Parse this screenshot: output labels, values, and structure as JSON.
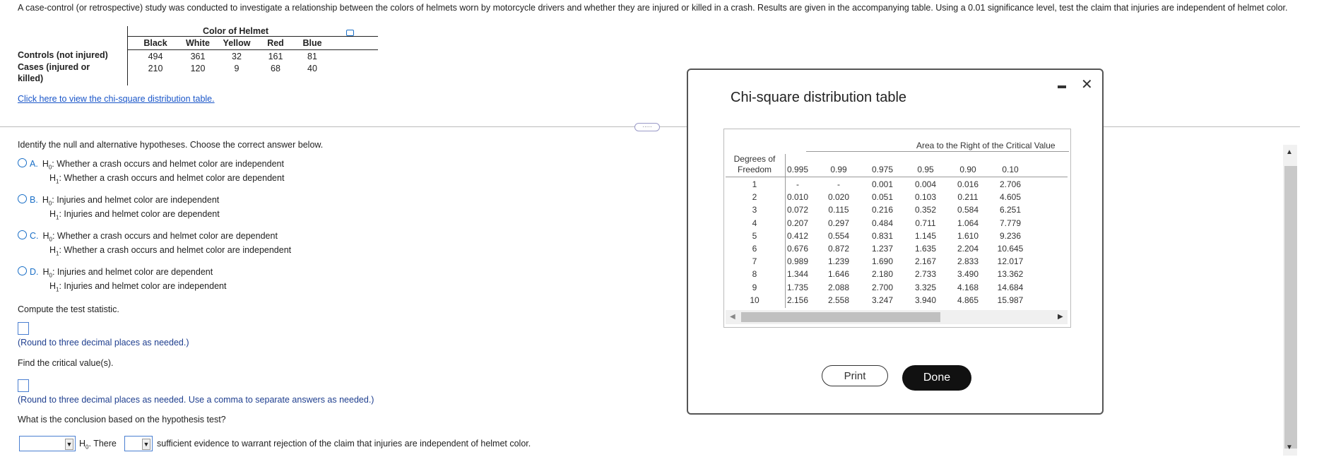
{
  "problem_text": "A case-control (or retrospective) study was conducted to investigate a relationship between the colors of helmets worn by motorcycle drivers and whether they are injured or killed in a crash. Results are given in the accompanying table. Using a 0.01 significance level, test the claim that injuries are independent of helmet color.",
  "data_table": {
    "group_header": "Color of Helmet",
    "columns": [
      "Black",
      "White",
      "Yellow",
      "Red",
      "Blue"
    ],
    "rows": [
      {
        "label": "Controls (not injured)",
        "values": [
          "494",
          "361",
          "32",
          "161",
          "81"
        ]
      },
      {
        "label": "Cases (injured or killed)",
        "values": [
          "210",
          "120",
          "9",
          "68",
          "40"
        ]
      }
    ]
  },
  "chi_link": "Click here to view the chi-square distribution table.",
  "question1": "Identify the null and alternative hypotheses. Choose the correct answer below.",
  "options": [
    {
      "letter": "A.",
      "h0": ": Whether a crash occurs and helmet color are independent",
      "h1": ": Whether a crash occurs and helmet color are dependent"
    },
    {
      "letter": "B.",
      "h0": ": Injuries and helmet color are independent",
      "h1": ": Injuries and helmet color are dependent"
    },
    {
      "letter": "C.",
      "h0": ": Whether a crash occurs and helmet color are dependent",
      "h1": ": Whether a crash occurs and helmet color are independent"
    },
    {
      "letter": "D.",
      "h0": ": Injuries and helmet color are dependent",
      "h1": ": Injuries and helmet color are independent"
    }
  ],
  "question2": "Compute the test statistic.",
  "note2": "(Round to three decimal places as needed.)",
  "question3": "Find the critical value(s).",
  "note3": "(Round to three decimal places as needed. Use a comma to separate answers as needed.)",
  "question4": "What is the conclusion based on the hypothesis test?",
  "conclusion": {
    "h0_prefix": "H",
    "there": ". There",
    "tail": "sufficient evidence to warrant rejection of the claim that injuries are independent of helmet color."
  },
  "modal": {
    "title": "Chi-square distribution table",
    "area_header": "Area to the Right of the Critical Value",
    "df_header": "Degrees of Freedom",
    "columns": [
      "0.995",
      "0.99",
      "0.975",
      "0.95",
      "0.90",
      "0.10"
    ],
    "rows": [
      {
        "df": "1",
        "vals": [
          "-",
          "-",
          "0.001",
          "0.004",
          "0.016",
          "2.706"
        ]
      },
      {
        "df": "2",
        "vals": [
          "0.010",
          "0.020",
          "0.051",
          "0.103",
          "0.211",
          "4.605"
        ]
      },
      {
        "df": "3",
        "vals": [
          "0.072",
          "0.115",
          "0.216",
          "0.352",
          "0.584",
          "6.251"
        ]
      },
      {
        "df": "4",
        "vals": [
          "0.207",
          "0.297",
          "0.484",
          "0.711",
          "1.064",
          "7.779"
        ]
      },
      {
        "df": "5",
        "vals": [
          "0.412",
          "0.554",
          "0.831",
          "1.145",
          "1.610",
          "9.236"
        ]
      },
      {
        "df": "6",
        "vals": [
          "0.676",
          "0.872",
          "1.237",
          "1.635",
          "2.204",
          "10.645"
        ]
      },
      {
        "df": "7",
        "vals": [
          "0.989",
          "1.239",
          "1.690",
          "2.167",
          "2.833",
          "12.017"
        ]
      },
      {
        "df": "8",
        "vals": [
          "1.344",
          "1.646",
          "2.180",
          "2.733",
          "3.490",
          "13.362"
        ]
      },
      {
        "df": "9",
        "vals": [
          "1.735",
          "2.088",
          "2.700",
          "3.325",
          "4.168",
          "14.684"
        ]
      },
      {
        "df": "10",
        "vals": [
          "2.156",
          "2.558",
          "3.247",
          "3.940",
          "4.865",
          "15.987"
        ]
      }
    ],
    "print_label": "Print",
    "done_label": "Done"
  },
  "colors": {
    "accent": "#1a6fc7",
    "link": "#1a56c9",
    "note": "#1f3f8f"
  }
}
